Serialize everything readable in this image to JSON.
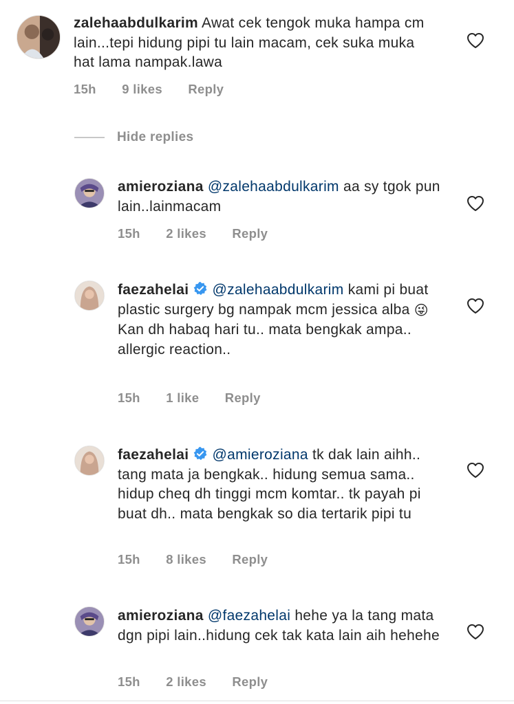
{
  "colors": {
    "text": "#262626",
    "secondary": "#8e8e8e",
    "mention": "#00376b",
    "verified": "#3897f0"
  },
  "hide_replies_label": "Hide replies",
  "comments": [
    {
      "username": "zalehaabdulkarim",
      "verified": false,
      "mention": "",
      "text": "Awat cek tengok muka hampa cm lain...tepi hidung pipi tu lain macam, cek suka muka hat lama nampak.lawa",
      "text2": "",
      "emoji": "",
      "time": "15h",
      "likes": "9 likes",
      "reply": "Reply",
      "icon": "heart-outline-icon"
    },
    {
      "username": "amieroziana",
      "verified": false,
      "mention": "@zalehaabdulkarim",
      "text": "aa sy tgok pun lain..lainmacam",
      "text2": "",
      "emoji": "",
      "time": "15h",
      "likes": "2 likes",
      "reply": "Reply",
      "icon": "heart-outline-icon"
    },
    {
      "username": "faezahelai",
      "verified": true,
      "mention": "@zalehaabdulkarim",
      "text": "kami pi buat plastic surgery bg nampak mcm jessica alba",
      "emoji": "😜",
      "text2": "Kan dh habaq hari tu.. mata bengkak ampa.. allergic reaction..",
      "time": "15h",
      "likes": "1 like",
      "reply": "Reply",
      "icon": "heart-outline-icon"
    },
    {
      "username": "faezahelai",
      "verified": true,
      "mention": "@amieroziana",
      "text": "tk dak lain aihh.. tang mata ja bengkak.. hidung semua sama.. hidup cheq dh tinggi mcm komtar.. tk payah pi buat dh.. mata bengkak so dia tertarik pipi tu",
      "text2": "",
      "emoji": "",
      "time": "15h",
      "likes": "8 likes",
      "reply": "Reply",
      "icon": "heart-outline-icon"
    },
    {
      "username": "amieroziana",
      "verified": false,
      "mention": "@faezahelai",
      "text": "hehe ya la tang mata dgn pipi lain..hidung cek tak kata lain aih hehehe",
      "text2": "",
      "emoji": "",
      "time": "15h",
      "likes": "2 likes",
      "reply": "Reply",
      "icon": "heart-outline-icon"
    }
  ]
}
